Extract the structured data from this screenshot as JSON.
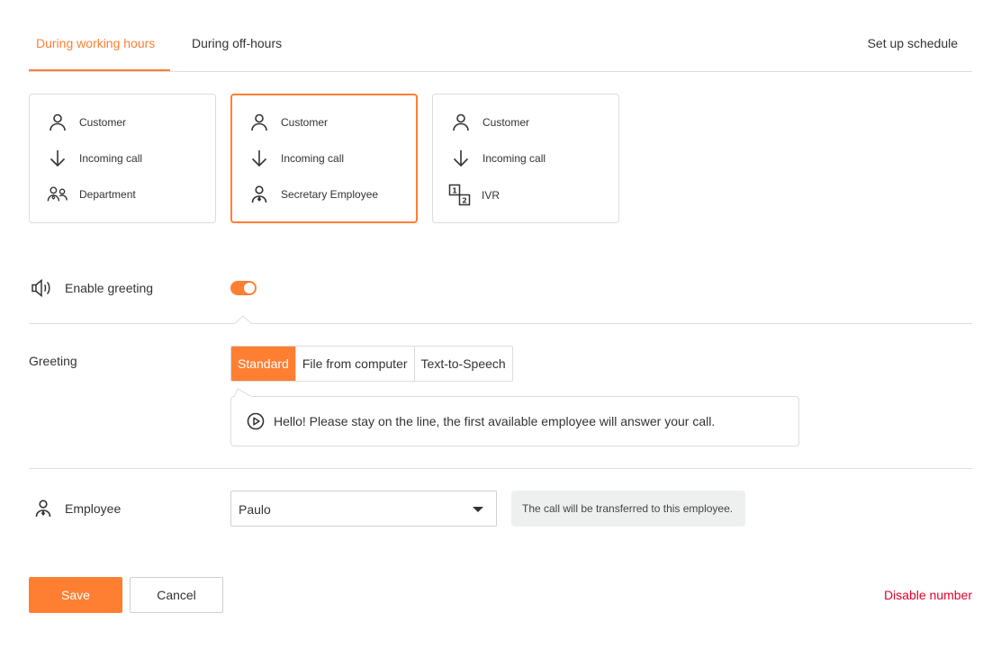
{
  "tabs": {
    "working": "During working hours",
    "off": "During off-hours",
    "active": "working"
  },
  "schedule_link": "Set up schedule",
  "scenarios": [
    {
      "selected": false,
      "rows": [
        {
          "icon": "person-icon",
          "label": "Customer"
        },
        {
          "icon": "arrow-down-icon",
          "label": "Incoming call"
        },
        {
          "icon": "group-icon",
          "label": "Department"
        }
      ]
    },
    {
      "selected": true,
      "rows": [
        {
          "icon": "person-icon",
          "label": "Customer"
        },
        {
          "icon": "arrow-down-icon",
          "label": "Incoming call"
        },
        {
          "icon": "employee-icon",
          "label": "Secretary Employee"
        }
      ]
    },
    {
      "selected": false,
      "rows": [
        {
          "icon": "person-icon",
          "label": "Customer"
        },
        {
          "icon": "arrow-down-icon",
          "label": "Incoming call"
        },
        {
          "icon": "ivr-icon",
          "label": "IVR"
        }
      ]
    }
  ],
  "greeting_toggle": {
    "label": "Enable greeting",
    "enabled": true,
    "icon": "speaker-icon"
  },
  "greeting": {
    "label": "Greeting",
    "options": [
      "Standard",
      "File from computer",
      "Text-to-Speech"
    ],
    "selected": "Standard",
    "message": "Hello! Please stay on the line, the first available employee will answer your call."
  },
  "employee": {
    "label": "Employee",
    "icon": "employee-icon",
    "value": "Paulo",
    "hint": "The call will be transferred to this employee."
  },
  "actions": {
    "save": "Save",
    "cancel": "Cancel",
    "disable": "Disable number"
  },
  "colors": {
    "accent": "#ff7f32",
    "danger": "#e3002b",
    "border": "#dcdcdc",
    "hint_bg": "#eef0f0"
  }
}
